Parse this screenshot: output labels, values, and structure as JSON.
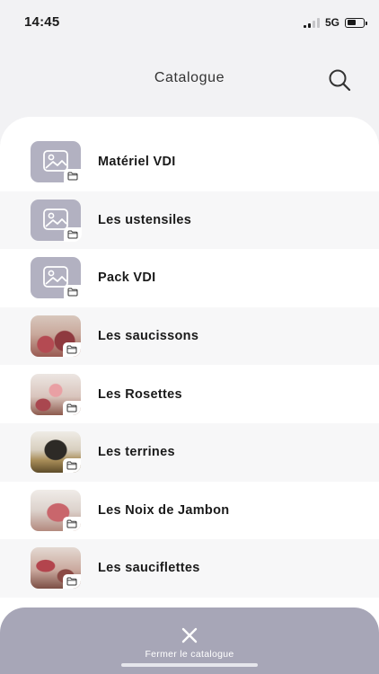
{
  "status_bar": {
    "time": "14:45",
    "network": "5G"
  },
  "header": {
    "title": "Catalogue"
  },
  "catalogue": {
    "items": [
      {
        "label": "Matériel VDI",
        "thumb": "placeholder"
      },
      {
        "label": "Les ustensiles",
        "thumb": "placeholder"
      },
      {
        "label": "Pack VDI",
        "thumb": "placeholder"
      },
      {
        "label": "Les saucissons",
        "thumb": "photo-saucissons"
      },
      {
        "label": "Les Rosettes",
        "thumb": "photo-rosettes"
      },
      {
        "label": "Les terrines",
        "thumb": "photo-terrines"
      },
      {
        "label": "Les Noix de Jambon",
        "thumb": "photo-jambon"
      },
      {
        "label": "Les sauciflettes",
        "thumb": "photo-sauciflettes"
      }
    ]
  },
  "footer": {
    "close_label": "Fermer le catalogue"
  },
  "colors": {
    "accent": "#a7a6b7",
    "placeholder": "#b2b1c1"
  }
}
